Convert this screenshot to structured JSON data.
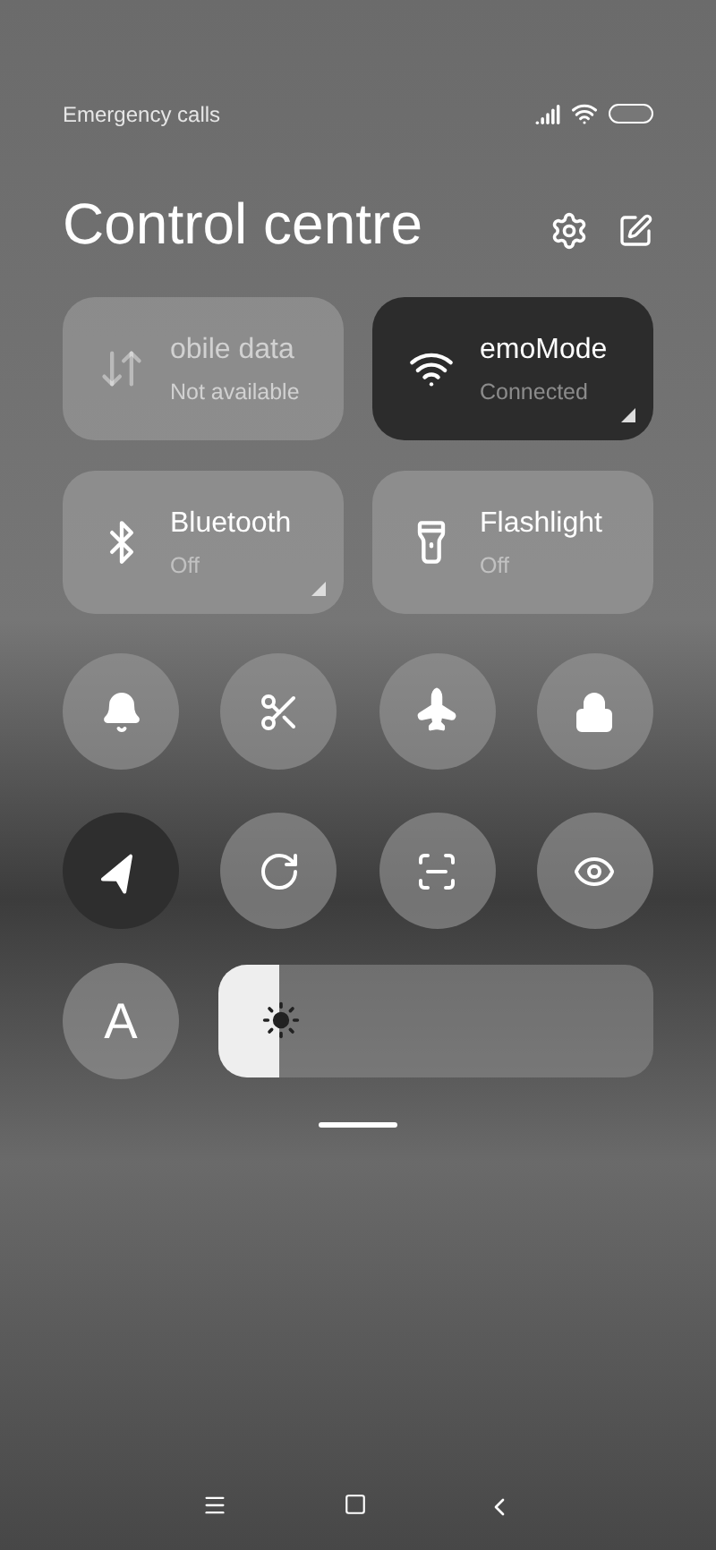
{
  "status_bar": {
    "carrier_text": "Emergency calls"
  },
  "header": {
    "title": "Control centre"
  },
  "tiles": [
    {
      "kind": "data",
      "label": "obile data",
      "status": "Not available",
      "on": false,
      "disabled": true,
      "expandable": false
    },
    {
      "kind": "wifi",
      "label": "emoMode",
      "status": "Connected",
      "on": true,
      "disabled": false,
      "expandable": true
    },
    {
      "kind": "bluetooth",
      "label": "Bluetooth",
      "status": "Off",
      "on": false,
      "disabled": false,
      "expandable": true
    },
    {
      "kind": "flashlight",
      "label": "Flashlight",
      "status": "Off",
      "on": false,
      "disabled": false,
      "expandable": false
    }
  ],
  "toggles": [
    {
      "kind": "bell",
      "on": false
    },
    {
      "kind": "screenshot",
      "on": false
    },
    {
      "kind": "airplane",
      "on": false
    },
    {
      "kind": "lock",
      "on": false
    },
    {
      "kind": "location",
      "on": true
    },
    {
      "kind": "rotation",
      "on": false
    },
    {
      "kind": "scanner",
      "on": false
    },
    {
      "kind": "reading",
      "on": false
    }
  ],
  "font_button": {
    "label": "A"
  },
  "brightness": {
    "level": 0.14
  }
}
